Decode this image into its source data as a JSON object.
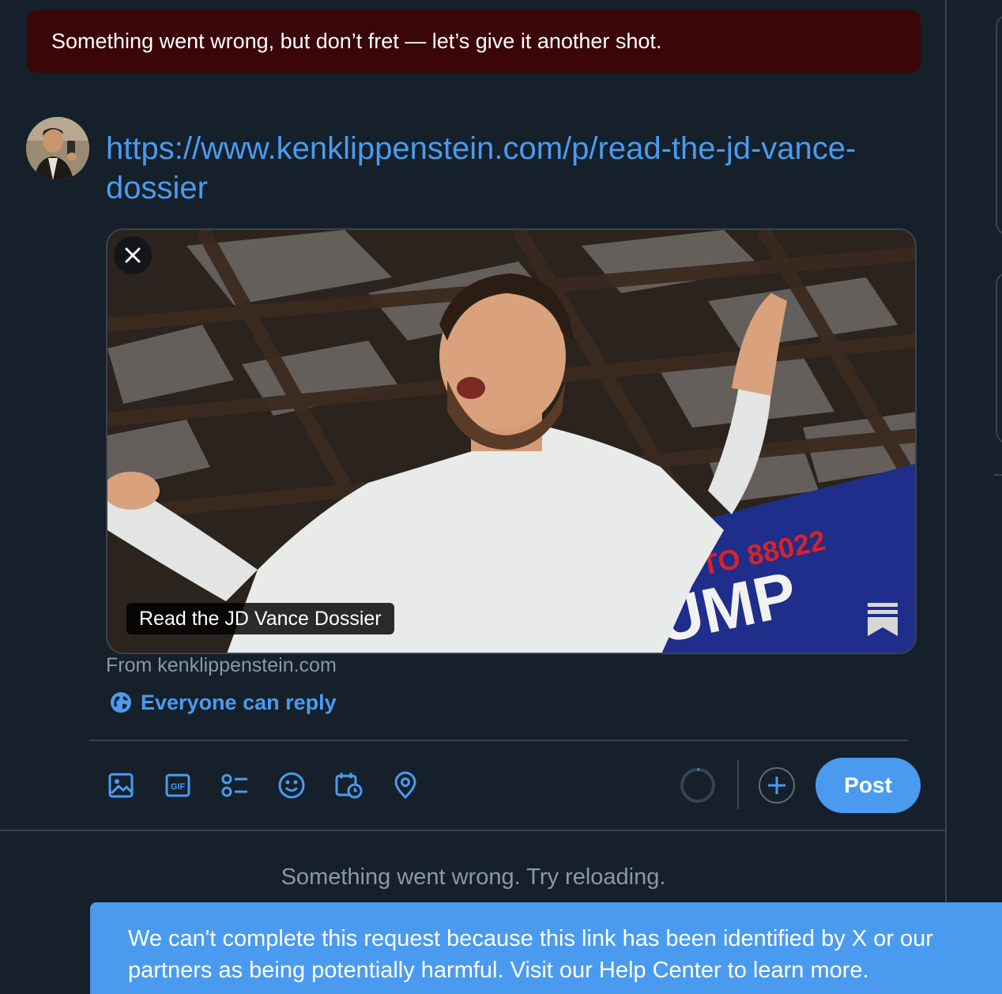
{
  "error_banner": {
    "text": "Something went wrong, but don’t fret — let’s give it another shot."
  },
  "composer": {
    "text": "https://www.kenklippenstein.com/p/read-the-jd-vance-dossier"
  },
  "link_card": {
    "title": "Read the JD Vance Dossier",
    "source": "From kenklippenstein.com",
    "sign_text_top": "TEXT PA TO 88022",
    "sign_text_main": "TRUMP"
  },
  "reply_setting": {
    "label": "Everyone can reply",
    "icon": "globe-icon"
  },
  "toolbar": {
    "tools": [
      "image-icon",
      "gif-icon",
      "poll-icon",
      "emoji-icon",
      "schedule-icon",
      "location-icon"
    ],
    "post_label": "Post"
  },
  "timeline": {
    "reload_message": "Something went wrong. Try reloading."
  },
  "toast": {
    "line1": "We can't complete this request because this link has been identified by X or our",
    "line2": "partners as being potentially harmful. Visit our Help Center to learn more."
  },
  "colors": {
    "background": "#15202b",
    "accent": "#4a9bf0",
    "error_banner": "#3a0607",
    "border": "#38444d",
    "muted_text": "#8b98a5"
  }
}
